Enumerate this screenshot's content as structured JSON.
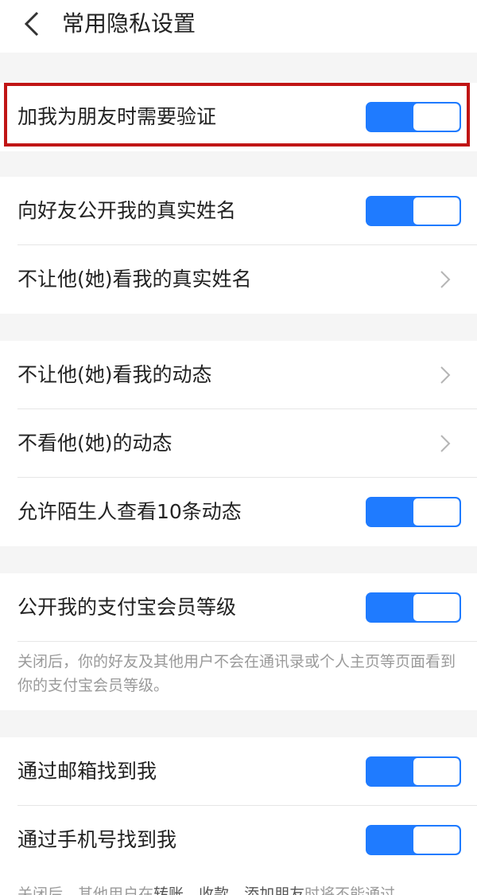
{
  "header": {
    "title": "常用隐私设置",
    "back_icon": "back-arrow-icon"
  },
  "settings": {
    "verify_friend": {
      "label": "加我为朋友时需要验证",
      "enabled": true
    },
    "public_real_name": {
      "label": "向好友公开我的真实姓名",
      "enabled": true
    },
    "hide_real_name": {
      "label": "不让他(她)看我的真实姓名"
    },
    "hide_moments_from": {
      "label": "不让他(她)看我的动态"
    },
    "dont_view_moments": {
      "label": "不看他(她)的动态"
    },
    "stranger_view_10": {
      "label": "允许陌生人查看10条动态",
      "enabled": true
    },
    "public_member_level": {
      "label": "公开我的支付宝会员等级",
      "enabled": true
    },
    "member_level_note": "关闭后，你的好友及其他用户不会在通讯录或个人主页等页面看到你的支付宝会员等级。",
    "find_by_email": {
      "label": "通过邮箱找到我",
      "enabled": true
    },
    "find_by_phone": {
      "label": "通过手机号找到我",
      "enabled": true
    },
    "footer_note_parts": [
      "关闭后，其他用户在",
      "转账",
      "、",
      "收款",
      "、",
      "添加朋友",
      "时将不能通过"
    ]
  },
  "colors": {
    "toggle_on": "#1f7bff",
    "highlight_border": "#c01515"
  }
}
